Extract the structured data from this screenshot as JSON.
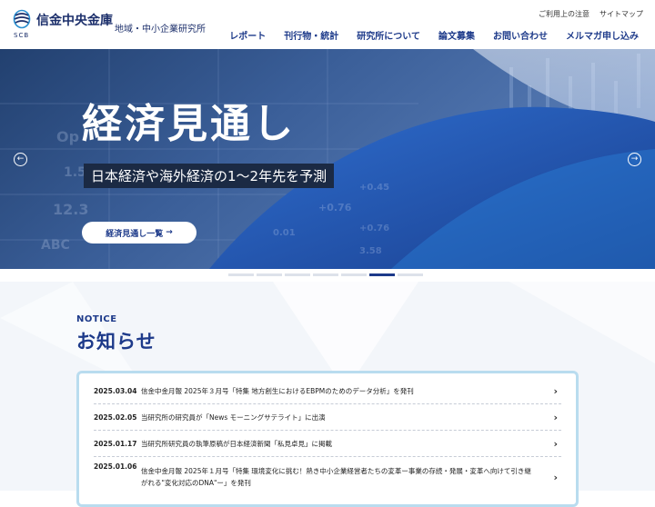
{
  "header": {
    "logo_name": "信金中央金庫",
    "logo_abbr": "SCB",
    "logo_subtitle": "地域・中小企業研究所",
    "util_links": [
      "ご利用上の注意",
      "サイトマップ"
    ],
    "nav": [
      "レポート",
      "刊行物・統計",
      "研究所について",
      "論文募集",
      "お問い合わせ",
      "メルマガ申し込み"
    ]
  },
  "hero": {
    "title": "経済見通し",
    "subtitle": "日本経済や海外経済の1〜2年先を予測",
    "button_label": "経済見通し一覧",
    "button_arrow": "→",
    "prev_icon": "←",
    "next_icon": "→",
    "bg_numbers": [
      "Op",
      "1.54",
      "12.3",
      "+0.76",
      "+0.76",
      "0.01",
      "+0.45",
      "ABC",
      "3.58"
    ]
  },
  "slider": {
    "count": 7,
    "active_index": 5
  },
  "notice": {
    "label_en": "NOTICE",
    "label_ja": "お知らせ",
    "items": [
      {
        "date": "2025.03.04",
        "text": "信金中金月報 2025年３月号「特集 地方創生におけるEBPMのためのデータ分析」を発刊"
      },
      {
        "date": "2025.02.05",
        "text": "当研究所の研究員が「News モーニングサテライト」に出演"
      },
      {
        "date": "2025.01.17",
        "text": "当研究所研究員の執筆原稿が日本経済新聞「私見卓見」に掲載"
      },
      {
        "date": "2025.01.06",
        "text": "信金中金月報 2025年１月号「特集 環境変化に挑む！熱き中小企業経営者たちの変革ー事業の存続・発展・変革へ向けて引き継がれる\"変化対応のDNA\"ー」を発刊"
      }
    ],
    "row_arrow": "›"
  },
  "colors": {
    "brand": "#1d3a8a",
    "hero_blue": "#2a4a8a",
    "box_border": "#b9dcef"
  }
}
